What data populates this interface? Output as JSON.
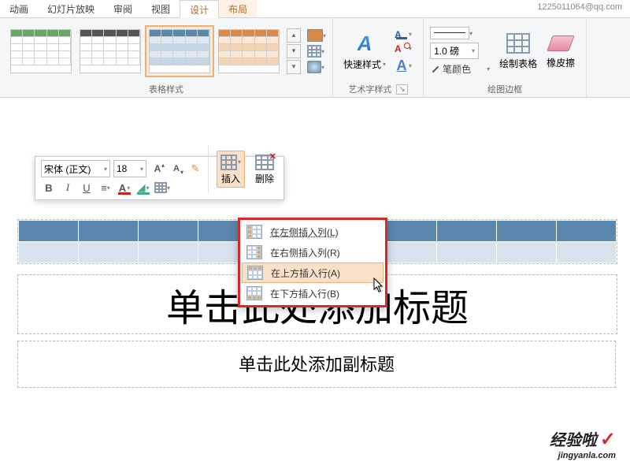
{
  "tabs": {
    "t0": "动画",
    "t1": "幻灯片放映",
    "t2": "审阅",
    "t3": "视图",
    "t4": "设计",
    "t5": "布局"
  },
  "user_email": "1225011064@qq.com",
  "ribbon": {
    "styles_label": "表格样式",
    "art_label": "艺术字样式",
    "quick_style": "快速样式",
    "border_label": "绘图边框",
    "weight": "1.0 磅",
    "pen_color": "笔颜色",
    "draw_table": "绘制表格",
    "eraser": "橡皮擦"
  },
  "mini": {
    "font": "宋体 (正文)",
    "size": "18",
    "insert": "插入",
    "delete": "删除"
  },
  "context": {
    "left": "在左侧插入列(L)",
    "right": "在右侧插入列(R)",
    "above": "在上方插入行(A)",
    "below": "在下方插入行(B)"
  },
  "slide": {
    "title": "单击此处添加标题",
    "subtitle": "单击此处添加副标题"
  },
  "watermark": {
    "brand": "经验啦",
    "url": "jingyanla.com"
  }
}
